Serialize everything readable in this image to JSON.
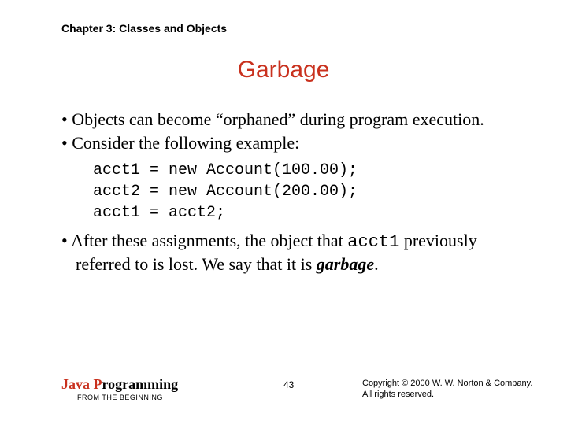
{
  "chapter_header": "Chapter 3: Classes and Objects",
  "slide_title": "Garbage",
  "bullets": {
    "b1": "Objects can become “orphaned” during program execution.",
    "b2": "Consider the following example:"
  },
  "code": "acct1 = new Account(100.00);\nacct2 = new Account(200.00);\nacct1 = acct2;",
  "para3": {
    "pre": "After these assignments, the object that ",
    "code": "acct1",
    "mid": " previously referred to is lost. We say that it is ",
    "strong": "garbage",
    "post": "."
  },
  "footer": {
    "book_java": "Java ",
    "book_prog_p": "P",
    "book_prog_rest": "rogramming",
    "book_subtitle": "FROM THE BEGINNING",
    "page": "43",
    "copyright_l1": "Copyright © 2000 W. W. Norton & Company.",
    "copyright_l2": "All rights reserved."
  }
}
